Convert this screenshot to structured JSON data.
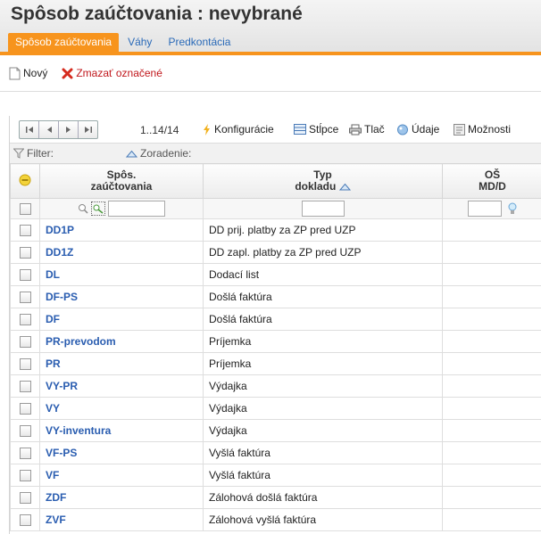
{
  "header": {
    "title": "Spôsob zaúčtovania :  nevybrané",
    "tabs": [
      "Spôsob zaúčtovania",
      "Váhy",
      "Predkontácia"
    ]
  },
  "toolbar": {
    "new_label": "Nový",
    "delete_label": "Zmazať označené"
  },
  "grid": {
    "range": "1..14/14",
    "config_label": "Konfigurácie",
    "columns_label": "Stĺpce",
    "print_label": "Tlač",
    "data_label": "Údaje",
    "options_label": "Možnosti",
    "filter_label": "Filter:",
    "sort_label": "Zoradenie:",
    "headers": {
      "col1_line1": "Spôs.",
      "col1_line2": "zaúčtovania",
      "col2_line1": "Typ",
      "col2_line2": "dokladu",
      "col3_line1": "OŠ",
      "col3_line2": "MD/D"
    },
    "rows": [
      {
        "code": "DD1P",
        "type": "DD prij. platby za ZP pred UZP",
        "os": ""
      },
      {
        "code": "DD1Z",
        "type": "DD zapl. platby za ZP pred UZP",
        "os": ""
      },
      {
        "code": "DL",
        "type": "Dodací list",
        "os": ""
      },
      {
        "code": "DF-PS",
        "type": "Došlá faktúra",
        "os": ""
      },
      {
        "code": "DF",
        "type": "Došlá faktúra",
        "os": ""
      },
      {
        "code": "PR-prevodom",
        "type": "Príjemka",
        "os": ""
      },
      {
        "code": "PR",
        "type": "Príjemka",
        "os": ""
      },
      {
        "code": "VY-PR",
        "type": "Výdajka",
        "os": ""
      },
      {
        "code": "VY",
        "type": "Výdajka",
        "os": ""
      },
      {
        "code": "VY-inventura",
        "type": "Výdajka",
        "os": ""
      },
      {
        "code": "VF-PS",
        "type": "Vyšlá faktúra",
        "os": ""
      },
      {
        "code": "VF",
        "type": "Vyšlá faktúra",
        "os": ""
      },
      {
        "code": "ZDF",
        "type": "Zálohová došlá faktúra",
        "os": ""
      },
      {
        "code": "ZVF",
        "type": "Zálohová vyšlá faktúra",
        "os": ""
      }
    ]
  },
  "colors": {
    "accent": "#f7941d",
    "link": "#2a5db0",
    "delete": "#c0161b"
  }
}
